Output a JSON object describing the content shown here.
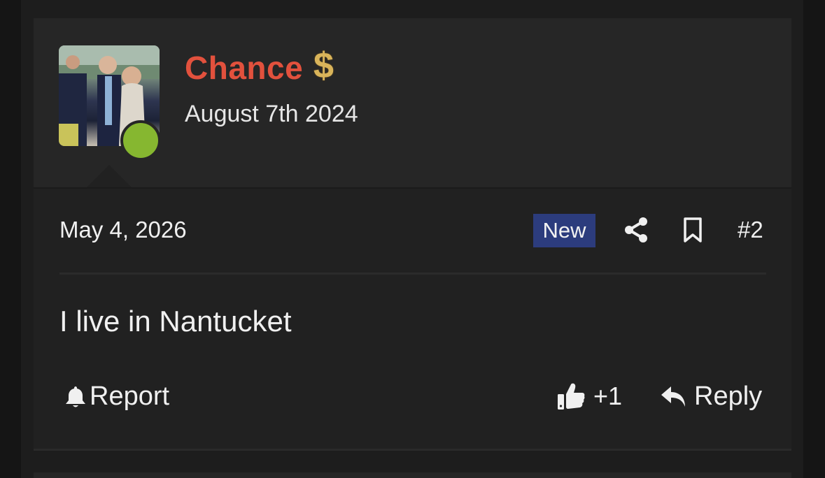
{
  "author": {
    "name": "Chance",
    "badge_icon": "dollar-icon",
    "badge_symbol": "$",
    "joined": "August 7th 2024",
    "online": true,
    "name_color": "#e2513d"
  },
  "post": {
    "date": "May 4, 2026",
    "new_label": "New",
    "number": "#2",
    "body": "I live in Nantucket"
  },
  "actions": {
    "report_label": "Report",
    "like_label": "+1",
    "reply_label": "Reply"
  },
  "icons": {
    "share": "share-icon",
    "bookmark": "bookmark-icon",
    "bell": "bell-icon",
    "thumbs_up": "thumbs-up-icon",
    "reply": "reply-icon"
  },
  "colors": {
    "new_badge": "#2c3c7d",
    "online": "#86b730",
    "badge_gold": "#d9b45a"
  }
}
